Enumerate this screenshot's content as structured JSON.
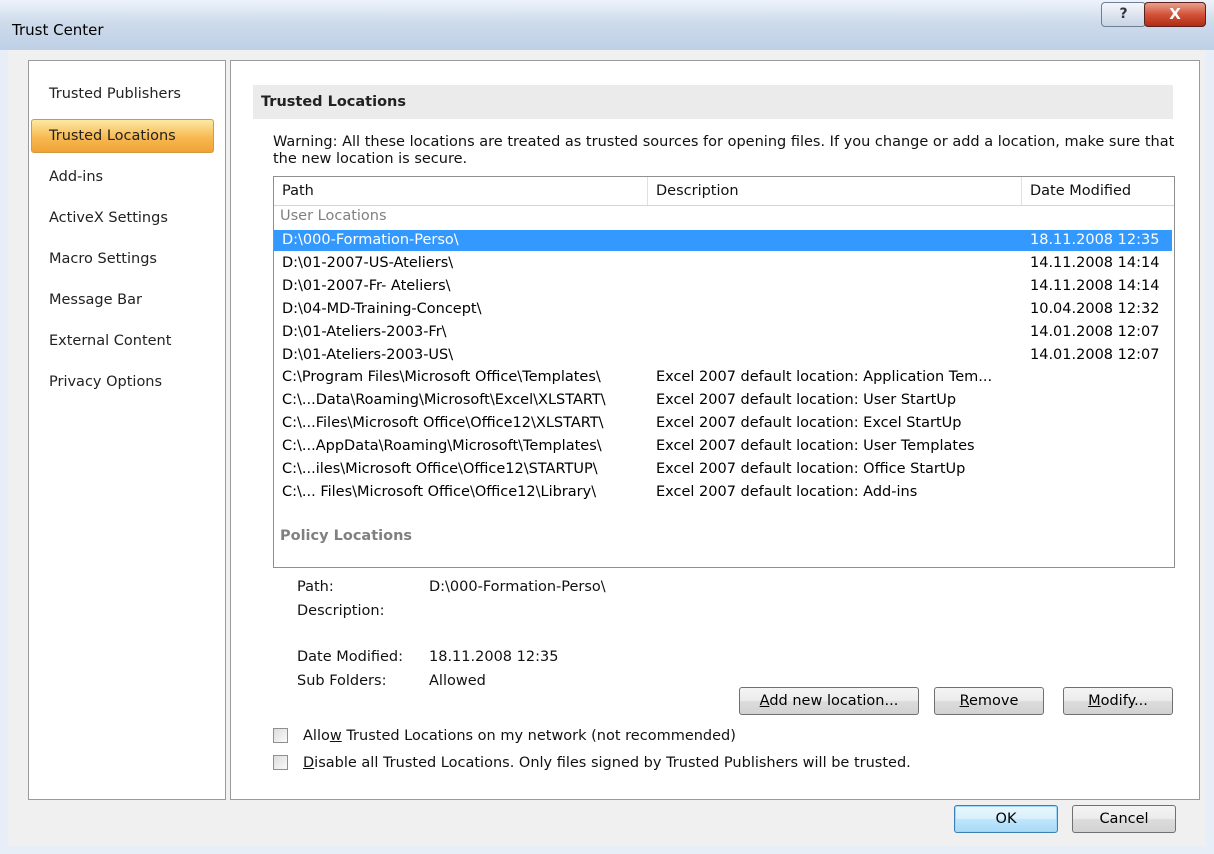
{
  "window": {
    "title": "Trust Center",
    "help_glyph": "?",
    "close_glyph": "X"
  },
  "nav": {
    "items": [
      {
        "label": "Trusted Publishers",
        "selected": false
      },
      {
        "label": "Trusted Locations",
        "selected": true
      },
      {
        "label": "Add-ins",
        "selected": false
      },
      {
        "label": "ActiveX Settings",
        "selected": false
      },
      {
        "label": "Macro Settings",
        "selected": false
      },
      {
        "label": "Message Bar",
        "selected": false
      },
      {
        "label": "External Content",
        "selected": false
      },
      {
        "label": "Privacy Options",
        "selected": false
      }
    ]
  },
  "main": {
    "header": "Trusted Locations",
    "warning": "Warning: All these locations are treated as trusted sources for opening files.  If you change or add a location, make sure that the new location is secure.",
    "list": {
      "columns": [
        "Path",
        "Description",
        "Date Modified"
      ],
      "user_group": "User Locations",
      "policy_group": "Policy Locations",
      "rows": [
        {
          "path": "D:\\000-Formation-Perso\\",
          "desc": "",
          "date": "18.11.2008 12:35",
          "selected": true
        },
        {
          "path": "D:\\01-2007-US-Ateliers\\",
          "desc": "",
          "date": "14.11.2008 14:14"
        },
        {
          "path": "D:\\01-2007-Fr- Ateliers\\",
          "desc": "",
          "date": "14.11.2008 14:14"
        },
        {
          "path": "D:\\04-MD-Training-Concept\\",
          "desc": "",
          "date": "10.04.2008 12:32"
        },
        {
          "path": "D:\\01-Ateliers-2003-Fr\\",
          "desc": "",
          "date": "14.01.2008 12:07"
        },
        {
          "path": "D:\\01-Ateliers-2003-US\\",
          "desc": "",
          "date": "14.01.2008 12:07"
        },
        {
          "path": "C:\\Program Files\\Microsoft Office\\Templates\\",
          "desc": "Excel 2007 default location: Application Tem...",
          "date": ""
        },
        {
          "path": "C:\\...Data\\Roaming\\Microsoft\\Excel\\XLSTART\\",
          "desc": "Excel 2007 default location: User StartUp",
          "date": ""
        },
        {
          "path": "C:\\...Files\\Microsoft Office\\Office12\\XLSTART\\",
          "desc": "Excel 2007 default location: Excel StartUp",
          "date": ""
        },
        {
          "path": "C:\\...AppData\\Roaming\\Microsoft\\Templates\\",
          "desc": "Excel 2007 default location: User Templates",
          "date": ""
        },
        {
          "path": "C:\\...iles\\Microsoft Office\\Office12\\STARTUP\\",
          "desc": "Excel 2007 default location: Office StartUp",
          "date": ""
        },
        {
          "path": "C:\\... Files\\Microsoft Office\\Office12\\Library\\",
          "desc": "Excel 2007 default location: Add-ins",
          "date": ""
        }
      ]
    },
    "details": {
      "path_label": "Path:",
      "path_value": "D:\\000-Formation-Perso\\",
      "description_label": "Description:",
      "date_label": "Date Modified:",
      "date_value": "18.11.2008 12:35",
      "subfolders_label": "Sub Folders:",
      "subfolders_value": "Allowed"
    },
    "buttons": {
      "add_pre": "",
      "add_key": "A",
      "add_post": "dd new location...",
      "remove_pre": "",
      "remove_key": "R",
      "remove_post": "emove",
      "modify_pre": "",
      "modify_key": "M",
      "modify_post": "odify..."
    },
    "checkboxes": {
      "network_pre": "Allo",
      "network_key": "w",
      "network_post": " Trusted Locations on my network (not recommended)",
      "network_checked": false,
      "disable_pre": "",
      "disable_key": "D",
      "disable_post": "isable all Trusted Locations. Only files signed by Trusted Publishers will be trusted.",
      "disable_checked": false
    }
  },
  "footer": {
    "ok": "OK",
    "cancel": "Cancel"
  },
  "colors": {
    "selection": "#3399ff",
    "nav_selected": "#f7b951"
  }
}
